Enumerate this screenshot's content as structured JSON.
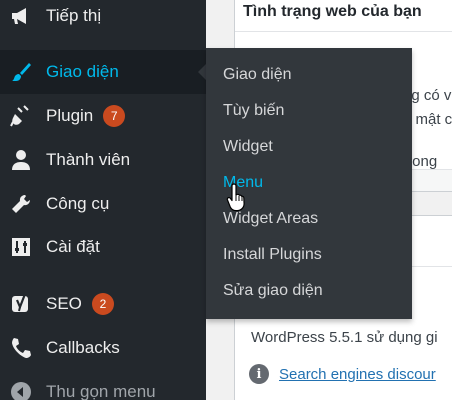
{
  "sidebar": {
    "items": [
      {
        "label": "Tiếp thị",
        "icon": "megaphone-icon"
      },
      {
        "label": "Giao diện",
        "icon": "paintbrush-icon",
        "active": true
      },
      {
        "label": "Plugin",
        "icon": "plug-icon",
        "badge": "7"
      },
      {
        "label": "Thành viên",
        "icon": "user-icon"
      },
      {
        "label": "Công cụ",
        "icon": "wrench-icon"
      },
      {
        "label": "Cài đặt",
        "icon": "sliders-icon"
      },
      {
        "label": "SEO",
        "icon": "yoast-icon",
        "badge": "2"
      },
      {
        "label": "Callbacks",
        "icon": "phone-icon"
      },
      {
        "label": "Thu gọn menu",
        "icon": "collapse-arrow-icon"
      }
    ]
  },
  "submenu": {
    "items": [
      {
        "label": "Giao diện"
      },
      {
        "label": "Tùy biến"
      },
      {
        "label": "Widget"
      },
      {
        "label": "Menu",
        "hover": true
      },
      {
        "label": "Widget Areas"
      },
      {
        "label": "Install Plugins"
      },
      {
        "label": "Sửa giao diện"
      }
    ]
  },
  "content": {
    "panel_title": "Tình trạng web của bạn",
    "text_1": "ng có v",
    "text_2": "o mật c",
    "text_3": "trong",
    "wp_version_text": "WordPress 5.5.1 sử dụng gi",
    "search_engines_link": "Search engines discour",
    "info_icon_glyph": "i"
  },
  "colors": {
    "sidebar_bg": "#23282d",
    "flyout_bg": "#32373c",
    "accent": "#00b9eb",
    "badge": "#ca4a1f",
    "link": "#2271b1"
  }
}
